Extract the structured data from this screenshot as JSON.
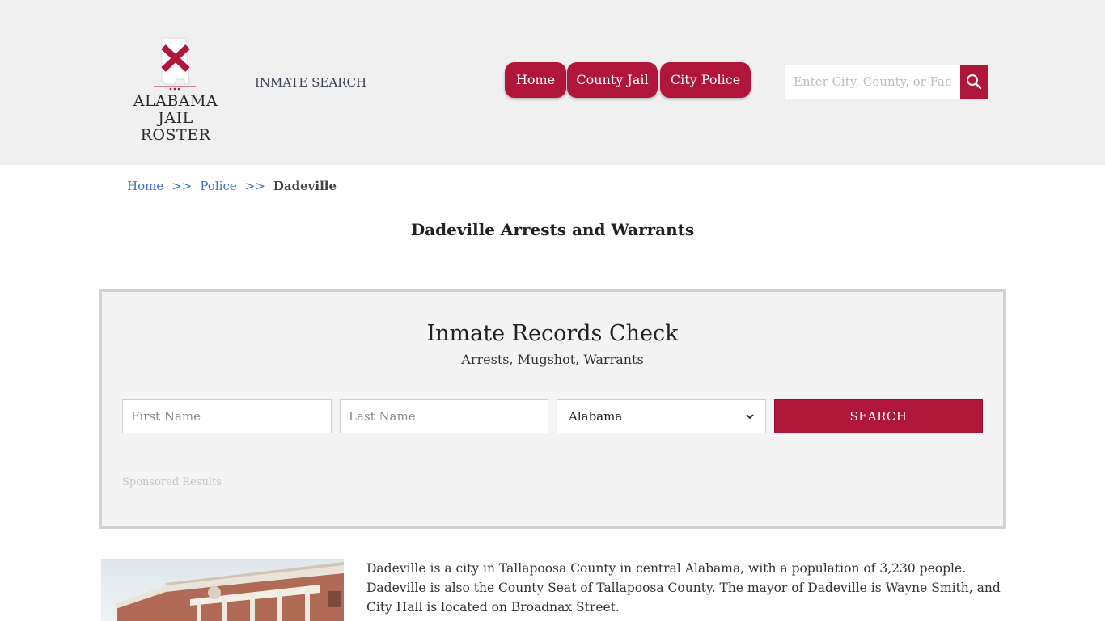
{
  "header": {
    "logo_line1": "ALABAMA",
    "logo_line2": "JAIL ROSTER",
    "inmate_search_link": "INMATE SEARCH",
    "nav": [
      {
        "label": "Home"
      },
      {
        "label": "County Jail"
      },
      {
        "label": "City Police"
      }
    ],
    "search_placeholder": "Enter City, County, or Facility",
    "search_icon": "magnifier-icon"
  },
  "breadcrumb": {
    "home": "Home",
    "sep1": ">>",
    "police": "Police",
    "sep2": ">>",
    "current": "Dadeville"
  },
  "page_title": "Dadeville Arrests and Warrants",
  "records": {
    "title": "Inmate Records Check",
    "subtitle": "Arrests, Mugshot, Warrants",
    "first_name_placeholder": "First Name",
    "last_name_placeholder": "Last Name",
    "state_selected": "Alabama",
    "search_button": "SEARCH",
    "sponsored": "Sponsored Results"
  },
  "description": "Dadeville is a city in Tallapoosa County in central Alabama, with a population of 3,230 people. Dadeville is also the County Seat of Tallapoosa County. The mayor of Dadeville is Wayne Smith, and City Hall is located on Broadnax Street.",
  "colors": {
    "brand": "#b0163a",
    "header_bg": "#f0f0f0",
    "link": "#3a6fc4"
  }
}
